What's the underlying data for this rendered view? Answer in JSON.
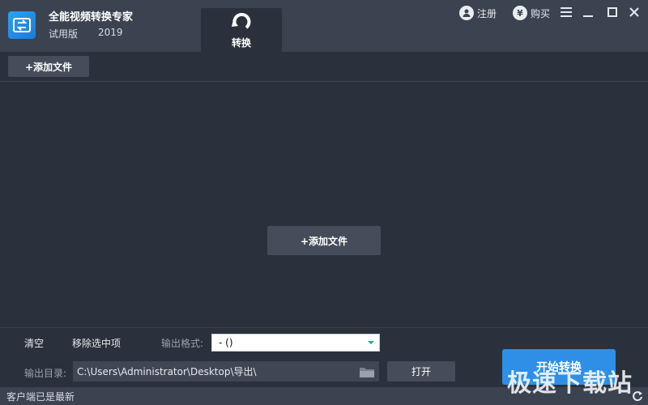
{
  "header": {
    "app_name": "全能视频转换专家",
    "edition": "试用版",
    "year": "2019",
    "tab_convert": "转换",
    "register": "注册",
    "buy": "购买",
    "buy_symbol": "¥"
  },
  "toolbar": {
    "add_file": "+添加文件"
  },
  "main": {
    "add_file_center": "+添加文件"
  },
  "bottom": {
    "clear": "清空",
    "remove_selected": "移除选中项",
    "output_format_label": "输出格式:",
    "output_format_value": "- ()",
    "output_dir_label": "输出目录:",
    "output_dir_value": "C:\\Users\\Administrator\\Desktop\\导出\\",
    "open": "打开",
    "start": "开始转换"
  },
  "status": {
    "text": "客户端已是最新"
  },
  "watermark": "极速下载站",
  "colors": {
    "background": "#2b313c",
    "titlebar": "#3b4250",
    "accent": "#2f8fe6",
    "button": "#454c5a"
  },
  "icons": [
    "app-logo-icon",
    "convert-tab-icon",
    "user-icon",
    "yen-icon",
    "menu-icon",
    "minimize-icon",
    "maximize-icon",
    "close-icon",
    "folder-icon",
    "refresh-icon"
  ]
}
